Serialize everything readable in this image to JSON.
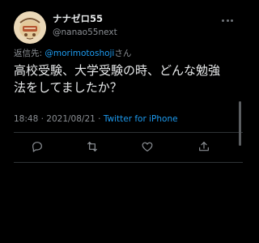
{
  "tweet": {
    "display_name": "ナナゼロ55",
    "handle": "@nanao55next",
    "reply_prefix": "返信先: ",
    "reply_mention": "@morimotoshoji",
    "reply_suffix": "さん",
    "text": "高校受験、大学受験の時、どんな勉強法をしてましたか？",
    "time": "18:48",
    "separator": " · ",
    "date": "2021/08/21",
    "source": "Twitter for iPhone"
  },
  "icons": {
    "avatar": "profile-avatar",
    "more": "more-icon",
    "actions": [
      "reply-icon",
      "retweet-icon",
      "like-icon",
      "share-icon"
    ]
  },
  "colors": {
    "background": "#000000",
    "text": "#e7e9ea",
    "secondary": "#8b8f94",
    "link": "#1d9bf0"
  }
}
